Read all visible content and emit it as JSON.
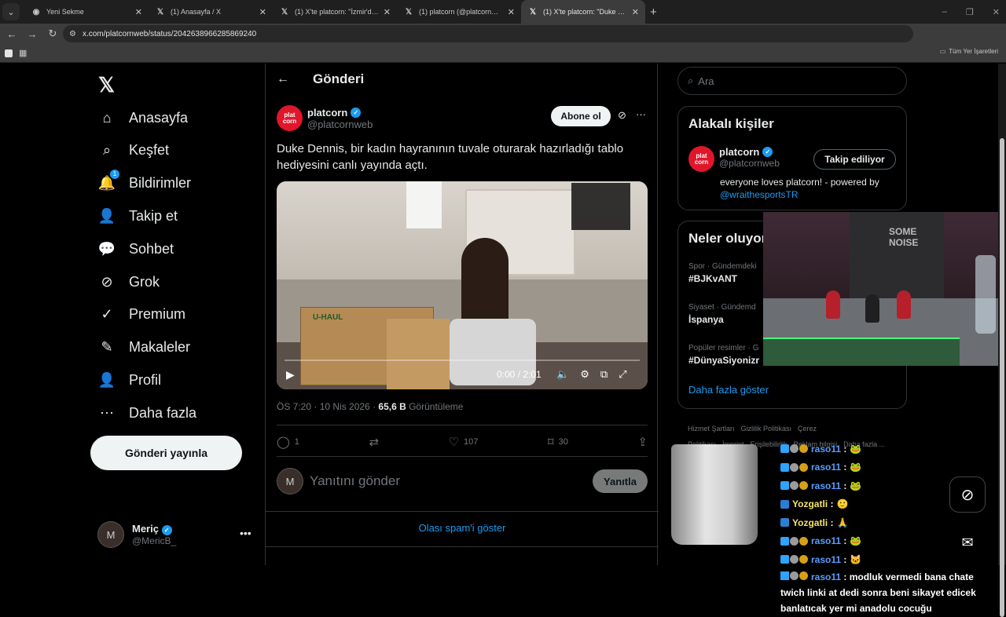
{
  "browser": {
    "tabs": [
      {
        "title": "Yeni Sekme",
        "icon": "chrome-icon"
      },
      {
        "title": "(1) Anasayfa / X",
        "icon": "x-icon"
      },
      {
        "title": "(1) X'te platcorn: \"İzmir'de IRL d",
        "icon": "x-icon"
      },
      {
        "title": "(1) platcorn (@platcornweb) / X",
        "icon": "x-icon"
      },
      {
        "title": "(1) X'te platcorn: \"Duke Dennis,",
        "icon": "x-icon"
      }
    ],
    "url": "x.com/platcornweb/status/2042638966285869240",
    "bookmarks_all": "Tüm Yer İşaretleri"
  },
  "nav": {
    "items": [
      {
        "label": "Anasayfa",
        "icon": "home-icon"
      },
      {
        "label": "Keşfet",
        "icon": "search-icon"
      },
      {
        "label": "Bildirimler",
        "icon": "bell-icon",
        "badge": "1"
      },
      {
        "label": "Takip et",
        "icon": "add-person-icon"
      },
      {
        "label": "Sohbet",
        "icon": "chat-icon"
      },
      {
        "label": "Grok",
        "icon": "grok-icon"
      },
      {
        "label": "Premium",
        "icon": "verified-icon"
      },
      {
        "label": "Makaleler",
        "icon": "articles-icon"
      },
      {
        "label": "Profil",
        "icon": "person-icon"
      },
      {
        "label": "Daha fazla",
        "icon": "more-circle-icon"
      }
    ],
    "post_button": "Gönderi yayınla",
    "me": {
      "name": "Meriç",
      "handle": "@MericB_"
    }
  },
  "post": {
    "header": "Gönderi",
    "author": {
      "name": "platcorn",
      "handle": "@platcornweb",
      "logo_text": "plat corn"
    },
    "subscribe": "Abone ol",
    "text": "Duke Dennis, bir kadın hayranının tuvale oturarak hazırladığı tablo hediyesini canlı yayında açtı.",
    "video": {
      "time": "0:00 / 2:01",
      "box_label": "U-HAUL",
      "progress": 0
    },
    "meta": {
      "time": "ÖS 7:20 · 10 Nis 2026 · ",
      "views": "65,6 B",
      "views_label": " Görüntüleme"
    },
    "actions": {
      "replies": "1",
      "likes": "107",
      "bookmarks": "30"
    },
    "reply_placeholder": "Yanıtını gönder",
    "reply_button": "Yanıtla",
    "spam_link": "Olası spam'i göster"
  },
  "sidebar": {
    "search_placeholder": "Ara",
    "relevant": {
      "title": "Alakalı kişiler",
      "name": "platcorn",
      "handle": "@platcornweb",
      "follow_button": "Takip ediliyor",
      "bio": "everyone loves platcorn! - powered by ",
      "bio_mention": "@wraithesportsTR"
    },
    "trends": {
      "title": "Neler oluyor",
      "items": [
        {
          "context": "Spor · Gündemdeki",
          "topic": "#BJKvANT"
        },
        {
          "context": "Siyaset · Gündemd",
          "topic": "İspanya"
        },
        {
          "context": "Popüler resimler · G",
          "topic": "#DünyaSiyonizr"
        }
      ],
      "more": "Daha fazla göster"
    },
    "footer": [
      "Hizmet Şartları",
      "Gizlilik Politikası",
      "Çerez Politikası",
      "İmprint",
      "Erişilebilirlik",
      "Reklam bilgisi",
      "Daha fazla ..."
    ]
  },
  "overlay": {
    "webcam_shirt_text": "SOME NOISE",
    "chat": [
      {
        "user": "raso11",
        "type": "badges",
        "color": "u-blue",
        "emote": "🐸"
      },
      {
        "user": "raso11",
        "type": "badges",
        "color": "u-blue",
        "emote": "🐸"
      },
      {
        "user": "raso11",
        "type": "badges",
        "color": "u-blue",
        "emote": "🐸"
      },
      {
        "user": "Yozgatli",
        "type": "twitch",
        "color": "u-yellow",
        "emote": "🙂"
      },
      {
        "user": "Yozgatli",
        "type": "twitch",
        "color": "u-yellow",
        "emote": "🙏"
      },
      {
        "user": "raso11",
        "type": "badges",
        "color": "u-blue",
        "emote": "🐸"
      },
      {
        "user": "raso11",
        "type": "badges",
        "color": "u-blue",
        "emote": "🐱"
      }
    ],
    "last_message": {
      "user": "raso11",
      "text": "modluk vermedi bana chate twich linki at dedi sonra beni sikayet edicek banlatıcak yer mi anadolu cocuğu"
    }
  }
}
